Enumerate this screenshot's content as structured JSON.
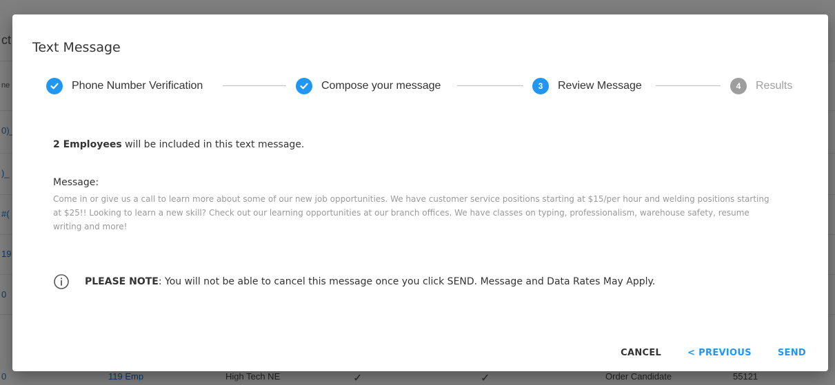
{
  "background": {
    "left_fragments": [
      "ct",
      "ne",
      "0)_",
      ")_",
      "#(",
      "19",
      "0"
    ],
    "bottom_row": [
      "0",
      "119 Emp",
      "High Tech NE",
      "✓",
      "✓",
      "Order Candidate",
      "55121"
    ]
  },
  "dialog": {
    "title": "Text Message",
    "steps": [
      {
        "number": "1",
        "label": "Phone Number Verification",
        "state": "completed"
      },
      {
        "number": "2",
        "label": "Compose your message",
        "state": "completed"
      },
      {
        "number": "3",
        "label": "Review Message",
        "state": "active"
      },
      {
        "number": "4",
        "label": "Results",
        "state": "pending"
      }
    ],
    "summary": {
      "count_label": "2 Employees",
      "suffix": " will be included in this text message."
    },
    "message": {
      "heading": "Message:",
      "body": "Come in or give us a call to learn more about some of our new job opportunities. We have customer service positions starting at $15/per hour and welding positions starting at $25!! Looking to learn a new skill? Check out our learning opportunities at our branch offices. We have classes on typing, professionalism, warehouse safety, resume writing and more!"
    },
    "note": {
      "strong": "PLEASE NOTE",
      "text": ": You will not be able to cancel this message once you click SEND. Message and Data Rates May Apply."
    },
    "actions": {
      "cancel": "CANCEL",
      "previous": "< PREVIOUS",
      "send": "SEND"
    }
  },
  "colors": {
    "accent": "#2196f3",
    "pending": "#9e9e9e",
    "message_text": "#999999"
  }
}
